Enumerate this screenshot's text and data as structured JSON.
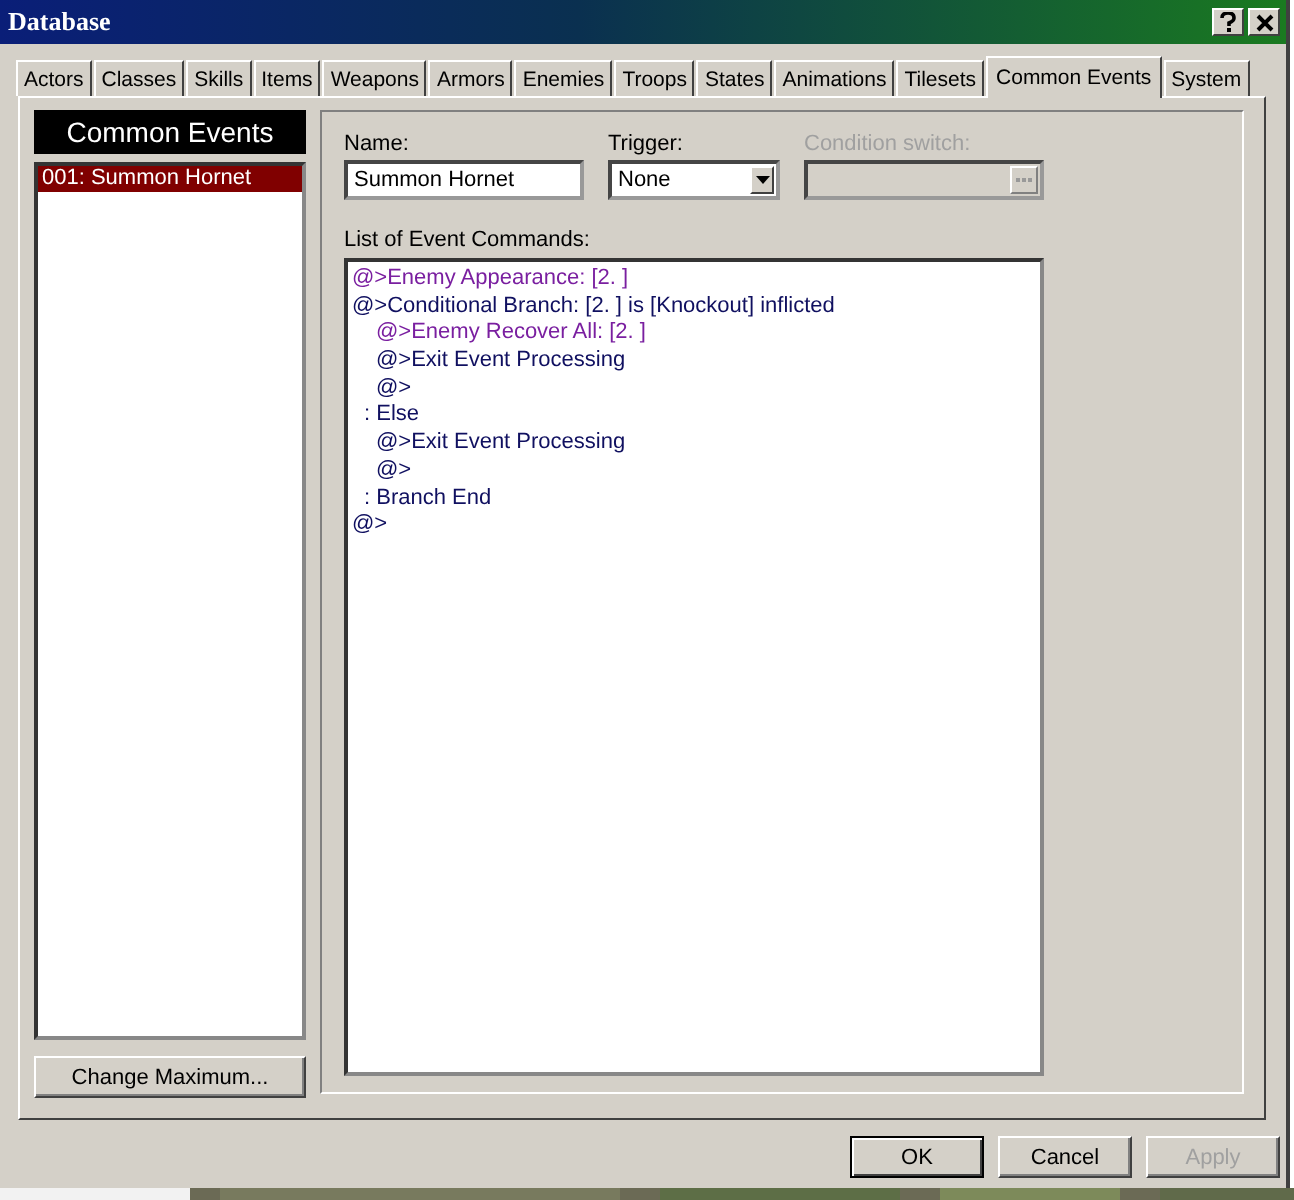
{
  "window": {
    "title": "Database"
  },
  "tabs": [
    {
      "label": "Actors",
      "selected": false
    },
    {
      "label": "Classes",
      "selected": false
    },
    {
      "label": "Skills",
      "selected": false
    },
    {
      "label": "Items",
      "selected": false
    },
    {
      "label": "Weapons",
      "selected": false
    },
    {
      "label": "Armors",
      "selected": false
    },
    {
      "label": "Enemies",
      "selected": false
    },
    {
      "label": "Troops",
      "selected": false
    },
    {
      "label": "States",
      "selected": false
    },
    {
      "label": "Animations",
      "selected": false
    },
    {
      "label": "Tilesets",
      "selected": false
    },
    {
      "label": "Common Events",
      "selected": true
    },
    {
      "label": "System",
      "selected": false
    }
  ],
  "sidebar": {
    "title": "Common Events",
    "items": [
      {
        "label": "001: Summon Hornet",
        "selected": true
      }
    ],
    "button": "Change Maximum..."
  },
  "name": {
    "label": "Name:",
    "value": "Summon Hornet"
  },
  "trigger": {
    "label": "Trigger:",
    "value": "None"
  },
  "condition_switch": {
    "label": "Condition switch:",
    "disabled": true
  },
  "commands": {
    "label": "List of Event Commands:",
    "items": [
      {
        "text": "@>Enemy Appearance: [2. ]",
        "kind": "battle"
      },
      {
        "text": "@>Conditional Branch: [2. ] is [Knockout] inflicted",
        "kind": "flow",
        "children": [
          {
            "text": "@>Enemy Recover All: [2. ]",
            "kind": "battle"
          },
          {
            "text": "@>Exit Event Processing",
            "kind": "flow"
          },
          {
            "text": "@>",
            "kind": "flow"
          }
        ]
      },
      {
        "text": ":  Else",
        "kind": "label",
        "children": [
          {
            "text": "@>Exit Event Processing",
            "kind": "flow"
          },
          {
            "text": "@>",
            "kind": "flow"
          }
        ]
      },
      {
        "text": ":  Branch End",
        "kind": "label"
      },
      {
        "text": "@>",
        "kind": "flow"
      }
    ]
  },
  "buttons": [
    {
      "label": "OK",
      "disabled": false
    },
    {
      "label": "Cancel",
      "disabled": false
    },
    {
      "label": "Apply",
      "disabled": true
    }
  ]
}
